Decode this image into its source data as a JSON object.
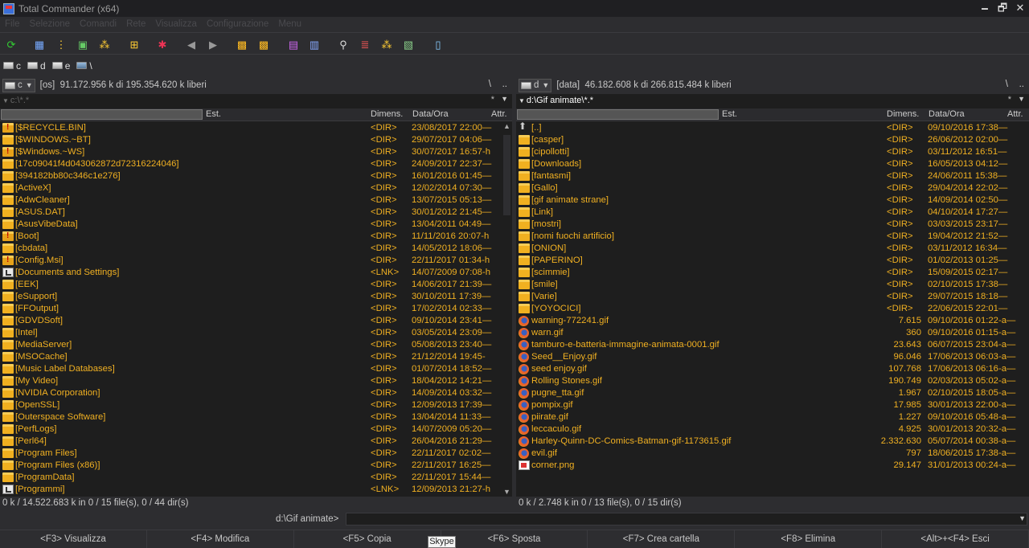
{
  "window": {
    "title": "Total Commander (x64)"
  },
  "menu": [
    "File",
    "Selezione",
    "Comandi",
    "Rete",
    "Visualizza",
    "Configurazione",
    "Menu"
  ],
  "drives": [
    {
      "letter": "c",
      "icon": "hdd-icon"
    },
    {
      "letter": "d",
      "icon": "hdd-icon"
    },
    {
      "letter": "e",
      "icon": "network-drive-icon"
    },
    {
      "letter": "\\",
      "icon": "network-icon"
    }
  ],
  "left": {
    "drive": "c",
    "label": "[os]",
    "free": "91.172.956 k di 195.354.620 k liberi",
    "path": "c:\\*.*",
    "root_btn": "\\",
    "up_btn": "..",
    "filter_star": "*",
    "columns": {
      "name": "",
      "ext": "Est.",
      "size": "Dimens.",
      "date": "Data/Ora",
      "attr": "Attr."
    },
    "files": [
      {
        "name": "[$RECYCLE.BIN]",
        "size": "<DIR>",
        "date": "23/08/2017 22:00—",
        "type": "folder-sys"
      },
      {
        "name": "[$WINDOWS.~BT]",
        "size": "<DIR>",
        "date": "29/07/2017 04:06—",
        "type": "folder"
      },
      {
        "name": "[$Windows.~WS]",
        "size": "<DIR>",
        "date": "30/07/2017 16:57-h",
        "type": "folder-sys"
      },
      {
        "name": "[17c09041f4d043062872d72316224046]",
        "size": "<DIR>",
        "date": "24/09/2017 22:37—",
        "type": "folder"
      },
      {
        "name": "[394182bb80c346c1e276]",
        "size": "<DIR>",
        "date": "16/01/2016 01:45—",
        "type": "folder"
      },
      {
        "name": "[ActiveX]",
        "size": "<DIR>",
        "date": "12/02/2014 07:30—",
        "type": "folder"
      },
      {
        "name": "[AdwCleaner]",
        "size": "<DIR>",
        "date": "13/07/2015 05:13—",
        "type": "folder"
      },
      {
        "name": "[ASUS.DAT]",
        "size": "<DIR>",
        "date": "30/01/2012 21:45—",
        "type": "folder"
      },
      {
        "name": "[AsusVibeData]",
        "size": "<DIR>",
        "date": "13/04/2011 04:49—",
        "type": "folder"
      },
      {
        "name": "[Boot]",
        "size": "<DIR>",
        "date": "11/11/2016 20:07-h",
        "type": "folder-sys"
      },
      {
        "name": "[cbdata]",
        "size": "<DIR>",
        "date": "14/05/2012 18:06—",
        "type": "folder"
      },
      {
        "name": "[Config.Msi]",
        "size": "<DIR>",
        "date": "22/11/2017 01:34-h",
        "type": "folder-sys"
      },
      {
        "name": "[Documents and Settings]",
        "size": "<LNK>",
        "date": "14/07/2009 07:08-h",
        "type": "lnk"
      },
      {
        "name": "[EEK]",
        "size": "<DIR>",
        "date": "14/06/2017 21:39—",
        "type": "folder"
      },
      {
        "name": "[eSupport]",
        "size": "<DIR>",
        "date": "30/10/2011 17:39—",
        "type": "folder"
      },
      {
        "name": "[FFOutput]",
        "size": "<DIR>",
        "date": "17/02/2014 02:33—",
        "type": "folder"
      },
      {
        "name": "[GDVDSoft]",
        "size": "<DIR>",
        "date": "09/10/2014 23:41—",
        "type": "folder"
      },
      {
        "name": "[Intel]",
        "size": "<DIR>",
        "date": "03/05/2014 23:09—",
        "type": "folder"
      },
      {
        "name": "[MediaServer]",
        "size": "<DIR>",
        "date": "05/08/2013 23:40—",
        "type": "folder"
      },
      {
        "name": "[MSOCache]",
        "size": "<DIR>",
        "date": "21/12/2014 19:45-",
        "type": "folder"
      },
      {
        "name": "[Music Label Databases]",
        "size": "<DIR>",
        "date": "01/07/2014 18:52—",
        "type": "folder"
      },
      {
        "name": "[My Video]",
        "size": "<DIR>",
        "date": "18/04/2012 14:21—",
        "type": "folder"
      },
      {
        "name": "[NVIDIA Corporation]",
        "size": "<DIR>",
        "date": "14/09/2014 03:32—",
        "type": "folder"
      },
      {
        "name": "[OpenSSL]",
        "size": "<DIR>",
        "date": "12/09/2013 17:39—",
        "type": "folder"
      },
      {
        "name": "[Outerspace Software]",
        "size": "<DIR>",
        "date": "13/04/2014 11:33—",
        "type": "folder"
      },
      {
        "name": "[PerfLogs]",
        "size": "<DIR>",
        "date": "14/07/2009 05:20—",
        "type": "folder"
      },
      {
        "name": "[Perl64]",
        "size": "<DIR>",
        "date": "26/04/2016 21:29—",
        "type": "folder"
      },
      {
        "name": "[Program Files]",
        "size": "<DIR>",
        "date": "22/11/2017 02:02—",
        "type": "folder"
      },
      {
        "name": "[Program Files (x86)]",
        "size": "<DIR>",
        "date": "22/11/2017 16:25—",
        "type": "folder"
      },
      {
        "name": "[ProgramData]",
        "size": "<DIR>",
        "date": "22/11/2017 15:44—",
        "type": "folder"
      },
      {
        "name": "[Programmi]",
        "size": "<LNK>",
        "date": "12/09/2013 21:27-h",
        "type": "lnk"
      }
    ],
    "status": "0 k / 14.522.683 k in 0 / 15 file(s), 0 / 44 dir(s)"
  },
  "right": {
    "drive": "d",
    "label": "[data]",
    "free": "46.182.608 k di 266.815.484 k liberi",
    "path": "d:\\Gif animate\\*.*",
    "root_btn": "\\",
    "up_btn": "..",
    "filter_star": "*",
    "columns": {
      "name": "",
      "ext": "Est.",
      "size": "Dimens.",
      "date": "Data/Ora",
      "attr": "Attr."
    },
    "files": [
      {
        "name": "[..]",
        "size": "<DIR>",
        "date": "09/10/2016 17:38—",
        "type": "up"
      },
      {
        "name": "[casper]",
        "size": "<DIR>",
        "date": "26/06/2012 02:00—",
        "type": "folder"
      },
      {
        "name": "[cipollotti]",
        "size": "<DIR>",
        "date": "03/11/2012 16:51—",
        "type": "folder"
      },
      {
        "name": "[Downloads]",
        "size": "<DIR>",
        "date": "16/05/2013 04:12—",
        "type": "folder"
      },
      {
        "name": "[fantasmi]",
        "size": "<DIR>",
        "date": "24/06/2011 15:38—",
        "type": "folder"
      },
      {
        "name": "[Gallo]",
        "size": "<DIR>",
        "date": "29/04/2014 22:02—",
        "type": "folder"
      },
      {
        "name": "[gif animate strane]",
        "size": "<DIR>",
        "date": "14/09/2014 02:50—",
        "type": "folder"
      },
      {
        "name": "[Link]",
        "size": "<DIR>",
        "date": "04/10/2014 17:27—",
        "type": "folder"
      },
      {
        "name": "[mostri]",
        "size": "<DIR>",
        "date": "03/03/2015 23:17—",
        "type": "folder"
      },
      {
        "name": "[nomi fuochi artificio]",
        "size": "<DIR>",
        "date": "19/04/2012 21:52—",
        "type": "folder"
      },
      {
        "name": "[ONION]",
        "size": "<DIR>",
        "date": "03/11/2012 16:34—",
        "type": "folder"
      },
      {
        "name": "[PAPERINO]",
        "size": "<DIR>",
        "date": "01/02/2013 01:25—",
        "type": "folder"
      },
      {
        "name": "[scimmie]",
        "size": "<DIR>",
        "date": "15/09/2015 02:17—",
        "type": "folder"
      },
      {
        "name": "[smile]",
        "size": "<DIR>",
        "date": "02/10/2015 17:38—",
        "type": "folder"
      },
      {
        "name": "[Varie]",
        "size": "<DIR>",
        "date": "29/07/2015 18:18—",
        "type": "folder"
      },
      {
        "name": "[YOYOCICI]",
        "size": "<DIR>",
        "date": "22/06/2015 22:01—",
        "type": "folder"
      },
      {
        "name": "warning-772241.gif",
        "size": "7.615",
        "date": "09/10/2016 01:22-a—",
        "type": "gif"
      },
      {
        "name": "warn.gif",
        "size": "360",
        "date": "09/10/2016 01:15-a—",
        "type": "gif"
      },
      {
        "name": "tamburo-e-batteria-immagine-animata-0001.gif",
        "size": "23.643",
        "date": "06/07/2015 23:04-a—",
        "type": "gif"
      },
      {
        "name": "Seed__Enjoy.gif",
        "size": "96.046",
        "date": "17/06/2013 06:03-a—",
        "type": "gif"
      },
      {
        "name": "seed enjoy.gif",
        "size": "107.768",
        "date": "17/06/2013 06:16-a—",
        "type": "gif"
      },
      {
        "name": "Rolling Stones.gif",
        "size": "190.749",
        "date": "02/03/2013 05:02-a—",
        "type": "gif"
      },
      {
        "name": "pugne_tta.gif",
        "size": "1.967",
        "date": "02/10/2015 18:05-a—",
        "type": "gif"
      },
      {
        "name": "pompix.gif",
        "size": "17.985",
        "date": "30/01/2013 22:00-a—",
        "type": "gif"
      },
      {
        "name": "piirate.gif",
        "size": "1.227",
        "date": "09/10/2016 05:48-a—",
        "type": "gif"
      },
      {
        "name": "leccaculo.gif",
        "size": "4.925",
        "date": "30/01/2013 20:32-a—",
        "type": "gif"
      },
      {
        "name": "Harley-Quinn-DC-Comics-Batman-gif-1173615.gif",
        "size": "2.332.630",
        "date": "05/07/2014 00:38-a—",
        "type": "gif"
      },
      {
        "name": "evil.gif",
        "size": "797",
        "date": "18/06/2015 17:38-a—",
        "type": "gif"
      },
      {
        "name": "corner.png",
        "size": "29.147",
        "date": "31/01/2013 00:24-a—",
        "type": "png"
      }
    ],
    "status": "0 k / 2.748 k in 0 / 13 file(s), 0 / 15 dir(s)"
  },
  "cmdline": {
    "label": "d:\\Gif animate>",
    "value": ""
  },
  "fkeys": [
    "<F3> Visualizza",
    "<F4> Modifica",
    "<F5> Copia",
    "<F6> Sposta",
    "<F7> Crea cartella",
    "<F8> Elimina",
    "<Alt>+<F4> Esci"
  ],
  "tooltip": "Skype"
}
